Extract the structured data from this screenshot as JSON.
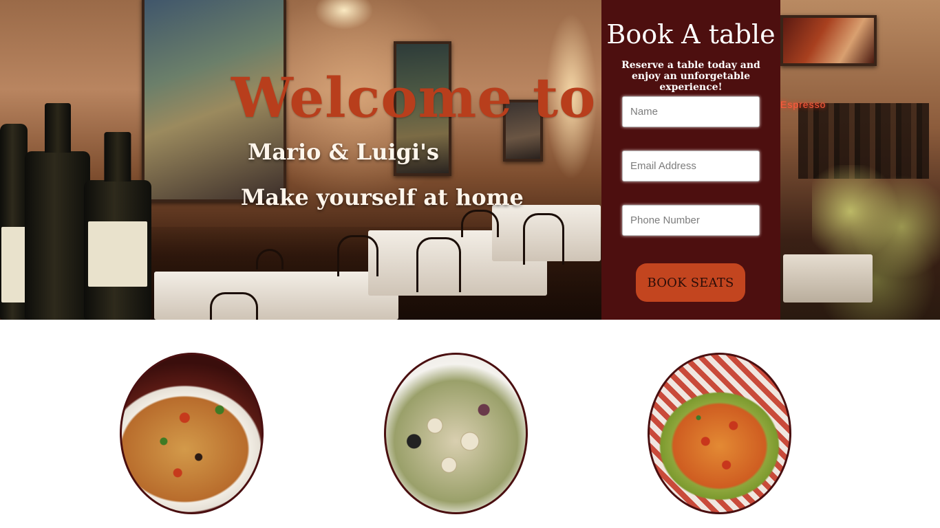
{
  "hero": {
    "welcome": "Welcome to",
    "brand": "Mario & Luigi's",
    "tagline": "Make yourself at home",
    "neon_sign": "Espresso"
  },
  "booking": {
    "title": "Book A table",
    "subtitle": "Reserve a table today and enjoy an unforgetable experience!",
    "name_placeholder": "Name",
    "email_placeholder": "Email Address",
    "phone_placeholder": "Phone Number",
    "button_label": "BOOK SEATS"
  },
  "colors": {
    "accent": "#c3451f",
    "panel": "#4d0f0f",
    "welcome_text": "#b83e1c"
  },
  "dishes": [
    {
      "name": "pizza-image"
    },
    {
      "name": "seafood-salad-image"
    },
    {
      "name": "pasta-image"
    }
  ]
}
